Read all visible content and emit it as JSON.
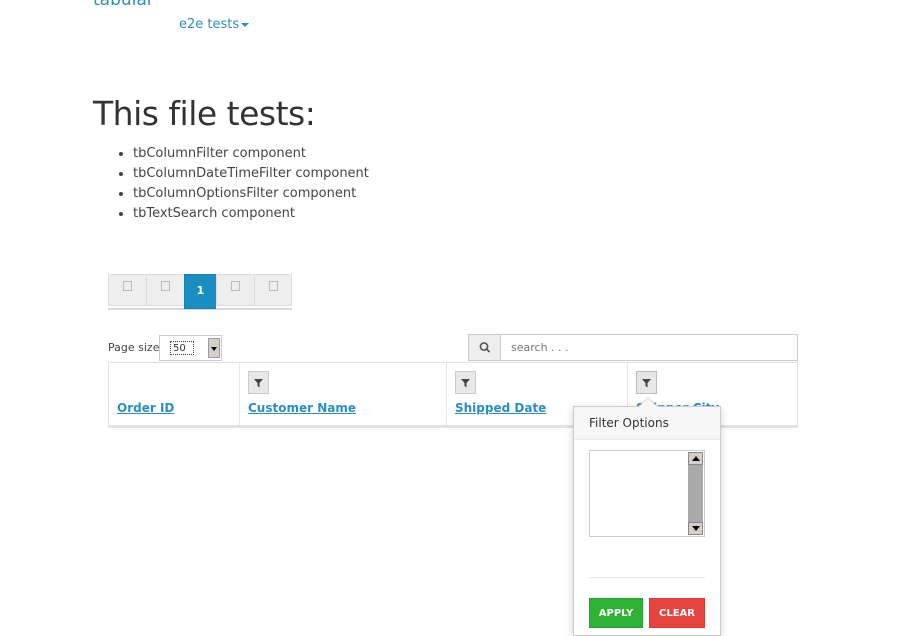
{
  "nav": {
    "brand": "tabular",
    "dropdown_label": "e2e tests"
  },
  "page": {
    "title": "This file tests:",
    "tests": [
      "tbColumnFilter component",
      "tbColumnDateTimeFilter component",
      "tbColumnOptionsFilter component",
      "tbTextSearch component"
    ]
  },
  "pager": {
    "current_page": "1"
  },
  "page_size": {
    "label": "Page size:",
    "value": "50"
  },
  "search": {
    "placeholder": "search . . ."
  },
  "table": {
    "columns": [
      {
        "label": "Order ID"
      },
      {
        "label": "Customer Name"
      },
      {
        "label": "Shipped Date"
      },
      {
        "label": "Shipper City"
      }
    ]
  },
  "filter_popover": {
    "title": "Filter Options",
    "apply_label": "APPLY",
    "clear_label": "CLEAR"
  },
  "colors": {
    "link": "#2a8fbd",
    "active_page": "#1b8ec1",
    "apply": "#2eb234",
    "clear": "#e9433f"
  }
}
